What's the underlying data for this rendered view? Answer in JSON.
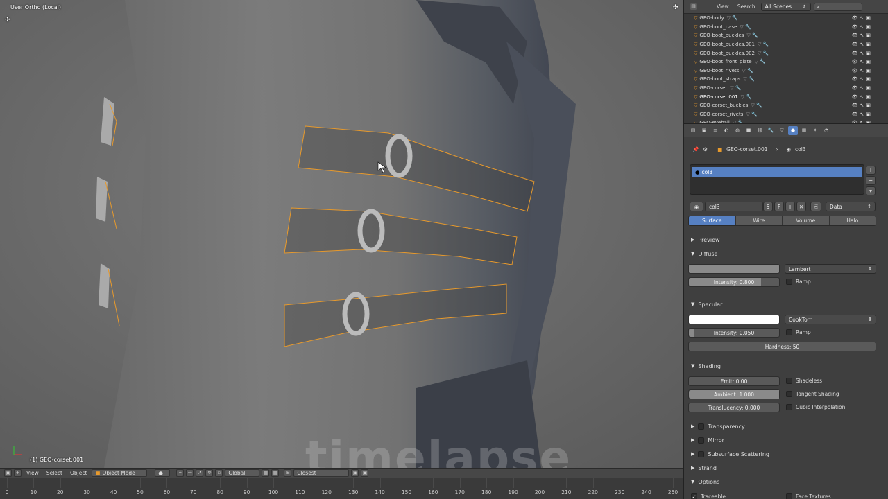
{
  "viewport": {
    "label": "User Ortho (Local)",
    "object_info": "(1) GEO-corset.001",
    "watermark": "timelapse"
  },
  "viewport_header": {
    "menu_view": "View",
    "menu_select": "Select",
    "menu_object": "Object",
    "mode": "Object Mode",
    "orientation": "Global",
    "snap_target": "Closest"
  },
  "timeline": {
    "ticks": [
      "0",
      "10",
      "20",
      "30",
      "40",
      "50",
      "60",
      "70",
      "80",
      "90",
      "100",
      "110",
      "120",
      "130",
      "140",
      "150",
      "160",
      "170",
      "180",
      "190",
      "200",
      "210",
      "220",
      "230",
      "240",
      "250"
    ]
  },
  "outliner": {
    "menu_view": "View",
    "menu_search": "Search",
    "scene_filter": "All Scenes",
    "items": [
      {
        "name": "GEO-body",
        "selected": false
      },
      {
        "name": "GEO-boot_base",
        "selected": false
      },
      {
        "name": "GEO-boot_buckles",
        "selected": false
      },
      {
        "name": "GEO-boot_buckles.001",
        "selected": false
      },
      {
        "name": "GEO-boot_buckles.002",
        "selected": false
      },
      {
        "name": "GEO-boot_front_plate",
        "selected": false
      },
      {
        "name": "GEO-boot_rivets",
        "selected": false
      },
      {
        "name": "GEO-boot_straps",
        "selected": false
      },
      {
        "name": "GEO-corset",
        "selected": false
      },
      {
        "name": "GEO-corset.001",
        "selected": true
      },
      {
        "name": "GEO-corset_buckles",
        "selected": false
      },
      {
        "name": "GEO-corset_rivets",
        "selected": false
      },
      {
        "name": "GEO-eyeball",
        "selected": false
      }
    ]
  },
  "properties": {
    "breadcrumb_object": "GEO-corset.001",
    "breadcrumb_material": "col3",
    "slot_name": "col3",
    "material_name": "col3",
    "material_users": "5",
    "fake_user": "F",
    "link": "Data",
    "tabs": [
      "Surface",
      "Wire",
      "Volume",
      "Halo"
    ],
    "active_tab": "Surface",
    "panels": {
      "preview": "Preview",
      "diffuse": "Diffuse",
      "specular": "Specular",
      "shading": "Shading",
      "transparency": "Transparency",
      "mirror": "Mirror",
      "sss": "Subsurface Scattering",
      "strand": "Strand",
      "options": "Options"
    },
    "diffuse": {
      "shader": "Lambert",
      "intensity_label": "Intensity: 0.800",
      "intensity": 0.8,
      "ramp": "Ramp",
      "color": "#8a8a8a"
    },
    "specular": {
      "shader": "CookTorr",
      "intensity_label": "Intensity: 0.050",
      "intensity": 0.05,
      "ramp": "Ramp",
      "hardness_label": "Hardness: 50",
      "color": "#ffffff"
    },
    "shading": {
      "emit": "Emit: 0.00",
      "ambient": "Ambient: 1.000",
      "translucency": "Translucency: 0.000",
      "shadeless": "Shadeless",
      "tangent": "Tangent Shading",
      "cubic": "Cubic Interpolation"
    },
    "options": {
      "traceable": "Traceable",
      "face_textures": "Face Textures"
    }
  },
  "colors": {
    "accent": "#5680c2",
    "selection": "#e89a2c",
    "viewport": "#6d6d6d"
  }
}
